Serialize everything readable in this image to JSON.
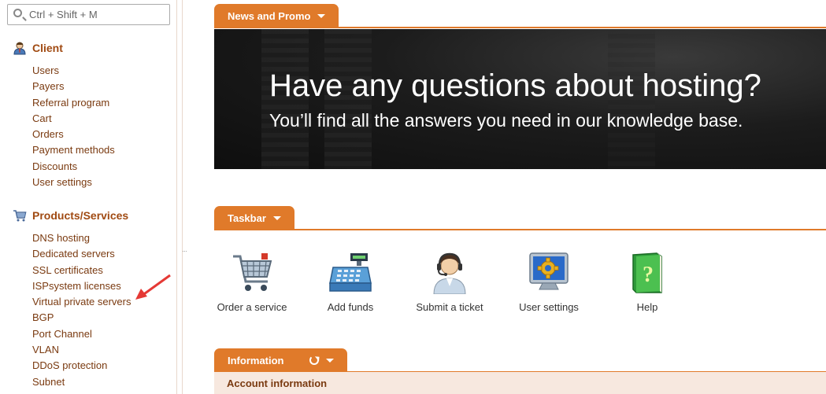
{
  "search": {
    "placeholder": "Ctrl + Shift + M"
  },
  "sidebar": {
    "groups": [
      {
        "title": "Client",
        "icon": "user-icon",
        "items": [
          "Users",
          "Payers",
          "Referral program",
          "Cart",
          "Orders",
          "Payment methods",
          "Discounts",
          "User settings"
        ]
      },
      {
        "title": "Products/Services",
        "icon": "cart-icon",
        "items": [
          "DNS hosting",
          "Dedicated servers",
          "SSL certificates",
          "ISPsystem licenses",
          "Virtual private servers",
          "BGP",
          "Port Channel",
          "VLAN",
          "DDoS protection",
          "Subnet"
        ]
      }
    ]
  },
  "panels": {
    "news": {
      "title": "News and Promo",
      "banner_heading": "Have any questions about hosting?",
      "banner_subheading": "You’ll find all the answers you need in our knowledge base."
    },
    "taskbar": {
      "title": "Taskbar",
      "items": [
        {
          "label": "Order a service",
          "icon": "shopping-cart-icon"
        },
        {
          "label": "Add funds",
          "icon": "cash-register-icon"
        },
        {
          "label": "Submit a ticket",
          "icon": "support-agent-icon"
        },
        {
          "label": "User settings",
          "icon": "monitor-gear-icon"
        },
        {
          "label": "Help",
          "icon": "help-book-icon"
        }
      ]
    },
    "information": {
      "title": "Information",
      "section": "Account information"
    }
  },
  "colors": {
    "accent": "#e07a2a",
    "link": "#7a3a10",
    "heading": "#a04a12",
    "annotation_arrow": "#e53935"
  }
}
